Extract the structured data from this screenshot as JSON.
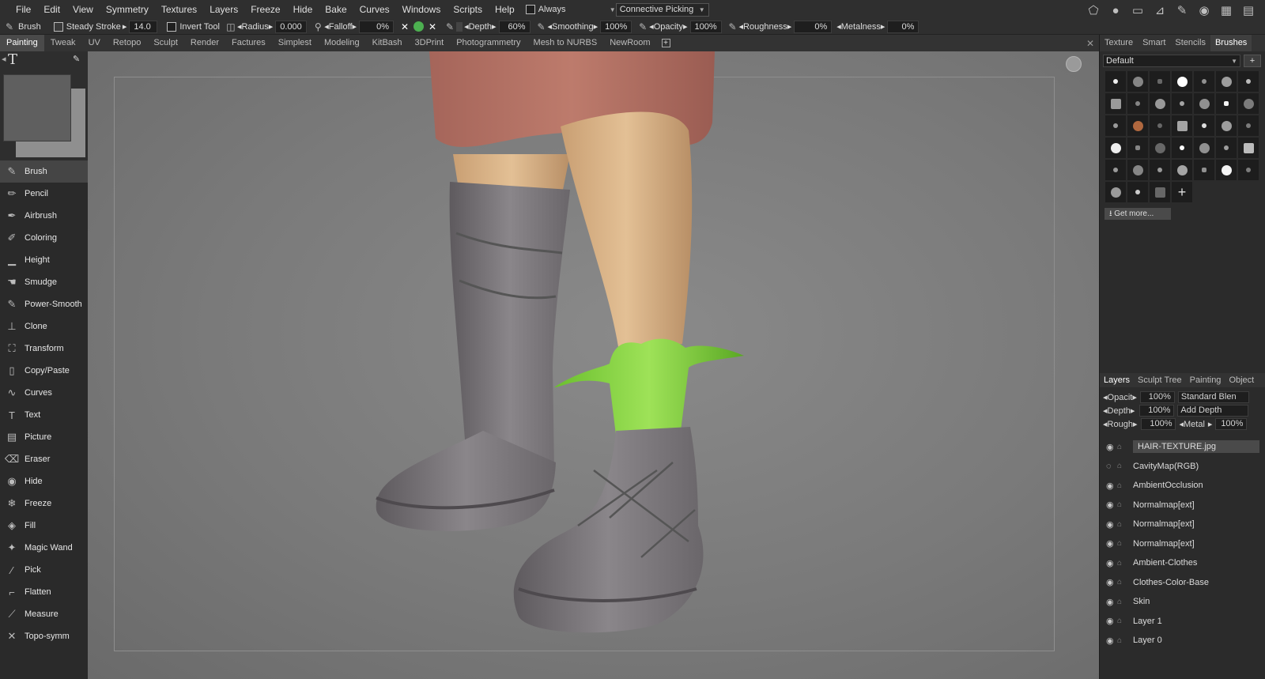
{
  "menu": [
    "File",
    "Edit",
    "View",
    "Symmetry",
    "Textures",
    "Layers",
    "Freeze",
    "Hide",
    "Bake",
    "Curves",
    "Windows",
    "Scripts",
    "Help"
  ],
  "always_dropdown": "Always",
  "picking_dropdown": "Connective Picking",
  "toolbar": {
    "tool": "Brush",
    "steady_stroke_label": "Steady Stroke",
    "steady_stroke_value": "14.0",
    "invert_tool_label": "Invert Tool",
    "radius_label": "Radius",
    "radius_value": "0.000",
    "falloff_label": "Falloff",
    "falloff_value": "0%",
    "depth_label": "Depth",
    "depth_value": "60%",
    "smoothing_label": "Smoothing",
    "smoothing_value": "100%",
    "opacity_label": "Opacity",
    "opacity_value": "100%",
    "roughness_label": "Roughness",
    "roughness_value": "0%",
    "metalness_label": "Metalness",
    "metalness_value": "0%"
  },
  "room_tabs": [
    "Painting",
    "Tweak",
    "UV",
    "Retopo",
    "Sculpt",
    "Render",
    "Factures",
    "Simplest",
    "Modeling",
    "KitBash",
    "3DPrint",
    "Photogrammetry",
    "Mesh to NURBS",
    "NewRoom"
  ],
  "tools": [
    "Brush",
    "Pencil",
    "Airbrush",
    "Coloring",
    "Height",
    "Smudge",
    "Power-Smooth",
    "Clone",
    "Transform",
    "Copy/Paste",
    "Curves",
    "Text",
    "Picture",
    "Eraser",
    "Hide",
    "Freeze",
    "Fill",
    "Magic Wand",
    "Pick",
    "Flatten",
    "Measure",
    "Topo-symm"
  ],
  "tool_icons": [
    "brush-icon",
    "pencil-icon",
    "airbrush-icon",
    "coloring-icon",
    "height-icon",
    "smudge-icon",
    "power-smooth-icon",
    "clone-icon",
    "transform-icon",
    "copy-paste-icon",
    "curves-icon",
    "text-icon",
    "picture-icon",
    "eraser-icon",
    "hide-icon",
    "freeze-icon",
    "fill-icon",
    "magic-wand-icon",
    "pick-icon",
    "flatten-icon",
    "measure-icon",
    "topo-symm-icon"
  ],
  "right_tabs": [
    "Texture",
    "Smart",
    "Stencils",
    "Brushes"
  ],
  "brush_preset": "Default",
  "get_more": "Get more...",
  "layer_tabs": [
    "Layers",
    "Sculpt Tree",
    "Painting",
    "Object"
  ],
  "layer_props": {
    "opacity_label": "Opacit",
    "opacity_value": "100%",
    "blend": "Standard Blen",
    "depth_label": "Depth",
    "depth_value": "100%",
    "depth_mode": "Add Depth",
    "rough_label": "Rough",
    "rough_value": "100%",
    "metal_label": "Metal",
    "metal_value": "100%"
  },
  "layers": [
    "HAIR-TEXTURE.jpg",
    "CavityMap(RGB)",
    "AmbientOcclusion",
    "Normalmap[ext]",
    "Normalmap[ext]",
    "Normalmap[ext]",
    "Ambient-Clothes",
    "Clothes-Color-Base",
    "Skin",
    "Layer 1",
    "Layer 0"
  ],
  "colors": {
    "accent_green": "#7fd13a",
    "skin": "#d9b48a",
    "boot": "#7e7a7e",
    "skirt": "#b27062"
  }
}
